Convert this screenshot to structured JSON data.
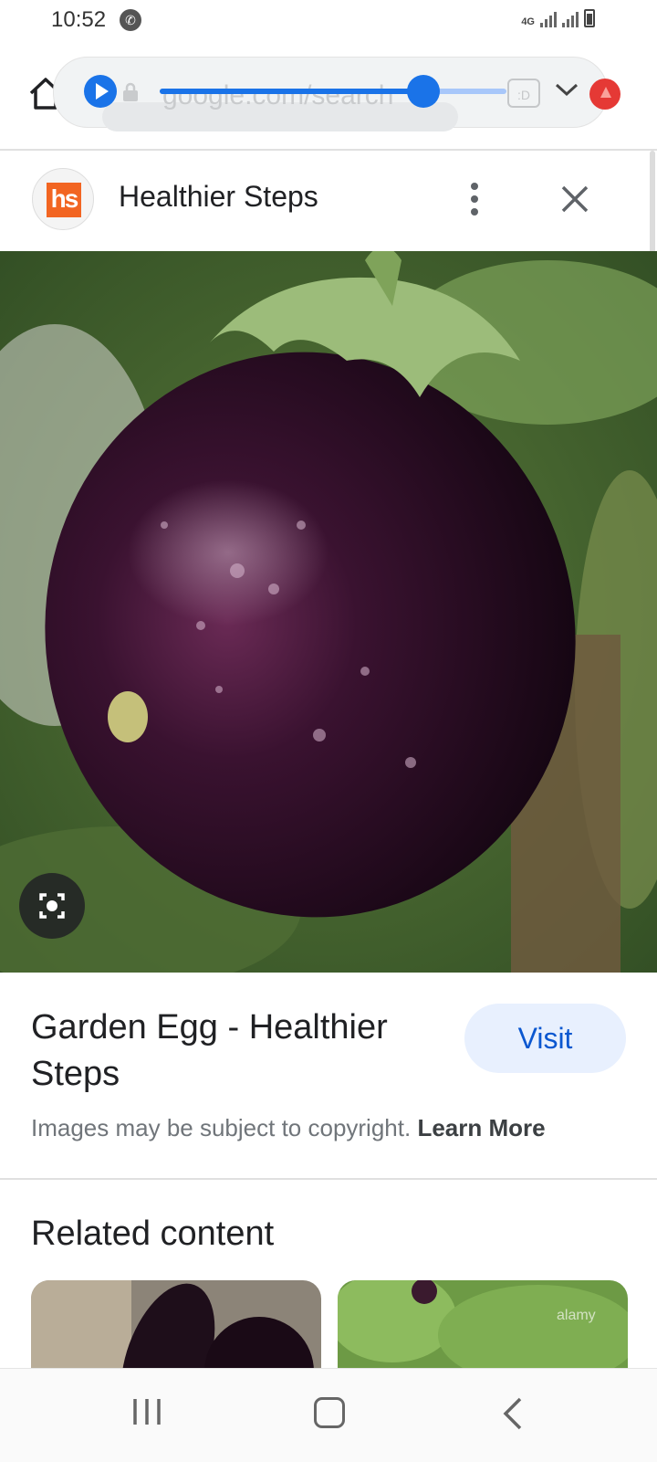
{
  "status_bar": {
    "time": "10:52",
    "network": "4G"
  },
  "browser": {
    "url": "google.com/search",
    "tab_icon_label": ":D",
    "colors": {
      "accent": "#1a73e8",
      "extension": "#e53935"
    },
    "media_progress": 0.76
  },
  "source": {
    "logo_text": "hs",
    "title": "Healthier Steps"
  },
  "image": {
    "subject": "eggplant",
    "lens_icon": "google-lens-icon"
  },
  "info": {
    "title": "Garden Egg - Healthier Steps",
    "visit_label": "Visit",
    "copyright_text": "Images may be subject to copyright.",
    "learn_more_label": "Learn More"
  },
  "related": {
    "heading": "Related content",
    "thumb2_watermark": "alamy"
  },
  "nav": {
    "recents_icon": "recents-icon",
    "home_icon": "home-icon",
    "back_icon": "back-icon"
  }
}
